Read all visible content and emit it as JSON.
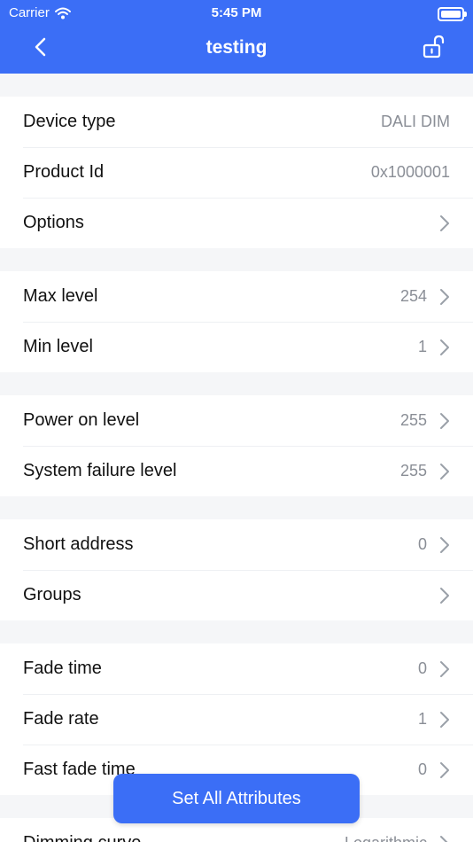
{
  "status_bar": {
    "carrier": "Carrier",
    "time": "5:45 PM"
  },
  "nav": {
    "title": "testing"
  },
  "sections": [
    [
      {
        "label": "Device type",
        "value": "DALI DIM",
        "chevron": false
      },
      {
        "label": "Product Id",
        "value": "0x1000001",
        "chevron": false
      },
      {
        "label": "Options",
        "value": "",
        "chevron": true
      }
    ],
    [
      {
        "label": "Max level",
        "value": "254",
        "chevron": true
      },
      {
        "label": "Min level",
        "value": "1",
        "chevron": true
      }
    ],
    [
      {
        "label": "Power on level",
        "value": "255",
        "chevron": true
      },
      {
        "label": "System failure level",
        "value": "255",
        "chevron": true
      }
    ],
    [
      {
        "label": "Short address",
        "value": "0",
        "chevron": true
      },
      {
        "label": "Groups",
        "value": "",
        "chevron": true
      }
    ],
    [
      {
        "label": "Fade time",
        "value": "0",
        "chevron": true
      },
      {
        "label": "Fade rate",
        "value": "1",
        "chevron": true
      },
      {
        "label": "Fast fade time",
        "value": "0",
        "chevron": true
      }
    ],
    [
      {
        "label": "Dimming curve",
        "value": "Logarithmic",
        "chevron": true
      }
    ]
  ],
  "action": {
    "label": "Set All Attributes"
  },
  "colors": {
    "primary": "#3b6ef6",
    "background": "#f5f6f8",
    "value_text": "#8a8e96"
  }
}
